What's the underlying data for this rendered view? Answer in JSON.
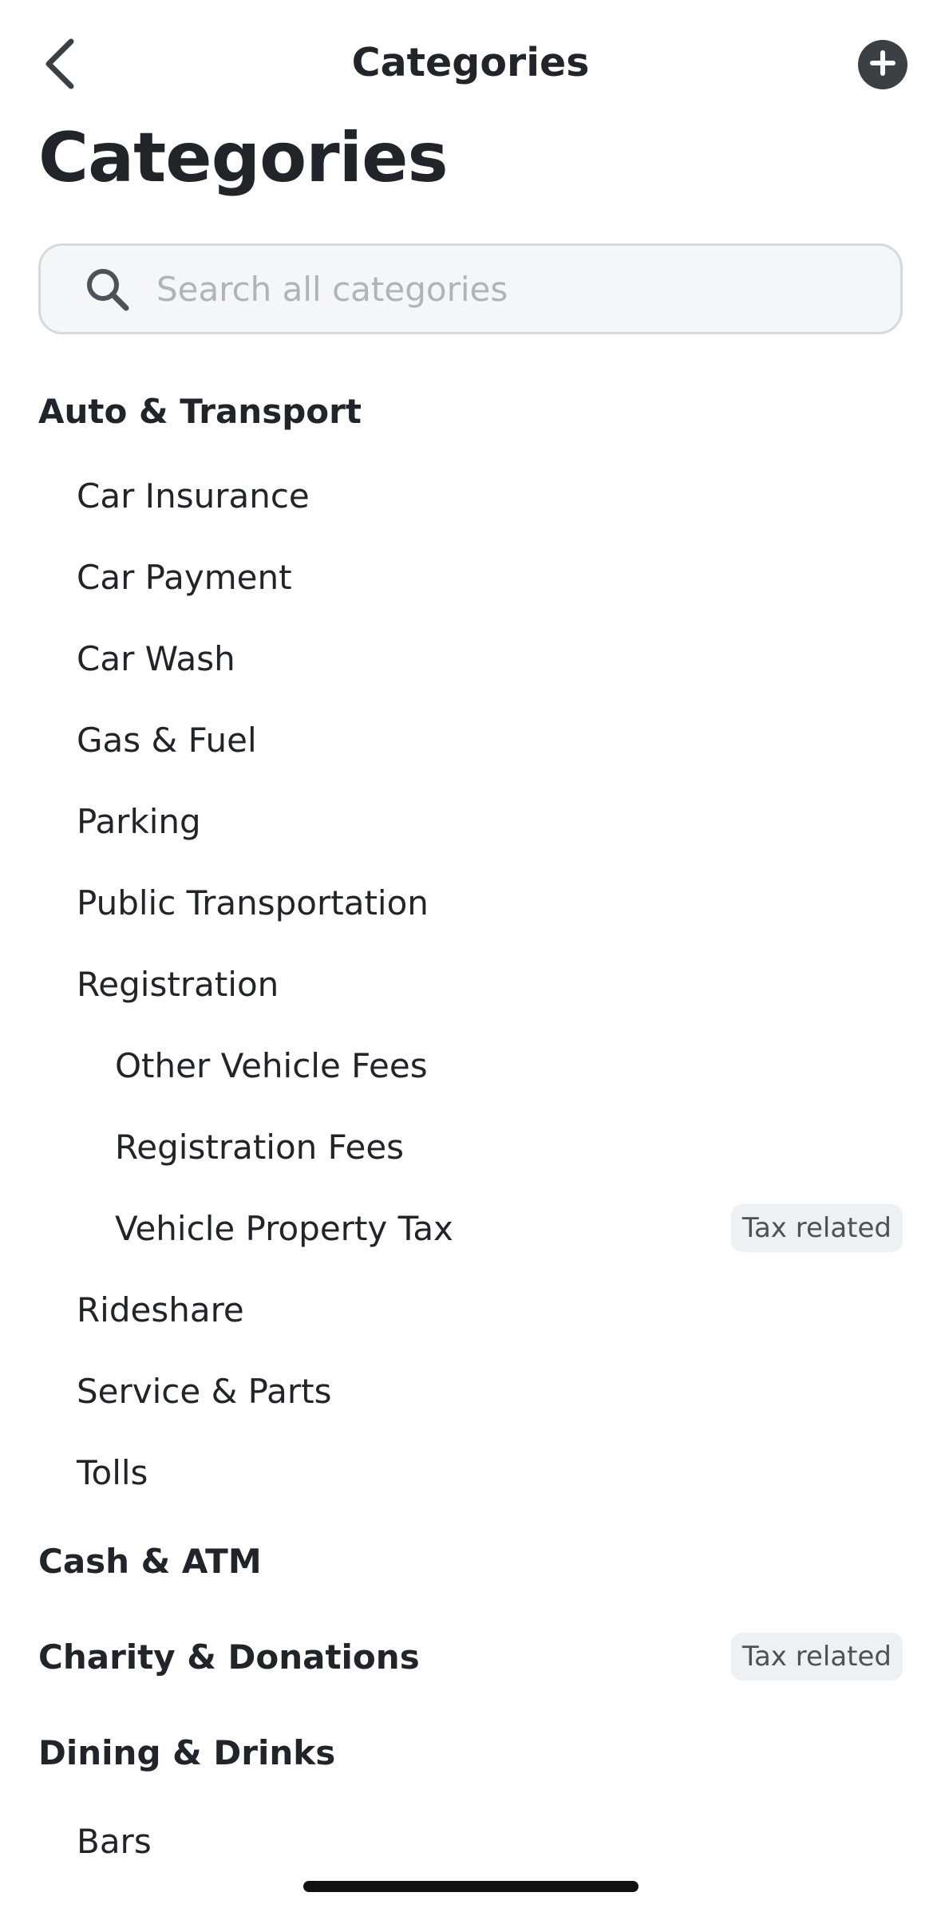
{
  "nav": {
    "title": "Categories",
    "back_icon": "chevron-left-icon",
    "add_icon": "plus-circle-icon"
  },
  "page": {
    "title": "Categories"
  },
  "search": {
    "placeholder": "Search all categories",
    "value": ""
  },
  "colors": {
    "text": "#212529",
    "badge_bg": "#eef1f3",
    "badge_text": "#4b5258",
    "search_bg": "#f4f6f7",
    "search_border": "#d5dadf",
    "placeholder": "#aeb4ba"
  },
  "categories": {
    "auto_transport": {
      "label": "Auto & Transport",
      "children": {
        "car_insurance": "Car Insurance",
        "car_payment": "Car Payment",
        "car_wash": "Car Wash",
        "gas_fuel": "Gas & Fuel",
        "parking": "Parking",
        "public_transportation": "Public Transportation",
        "registration": "Registration",
        "other_vehicle_fees": "Other Vehicle Fees",
        "registration_fees": "Registration Fees",
        "vehicle_property_tax": "Vehicle Property Tax",
        "vehicle_property_tax_badge": "Tax related",
        "rideshare": "Rideshare",
        "service_parts": "Service & Parts",
        "tolls": "Tolls"
      }
    },
    "cash_atm": {
      "label": "Cash & ATM"
    },
    "charity_donations": {
      "label": "Charity & Donations",
      "badge": "Tax related"
    },
    "dining_drinks": {
      "label": "Dining & Drinks",
      "children": {
        "bars": "Bars"
      }
    }
  }
}
